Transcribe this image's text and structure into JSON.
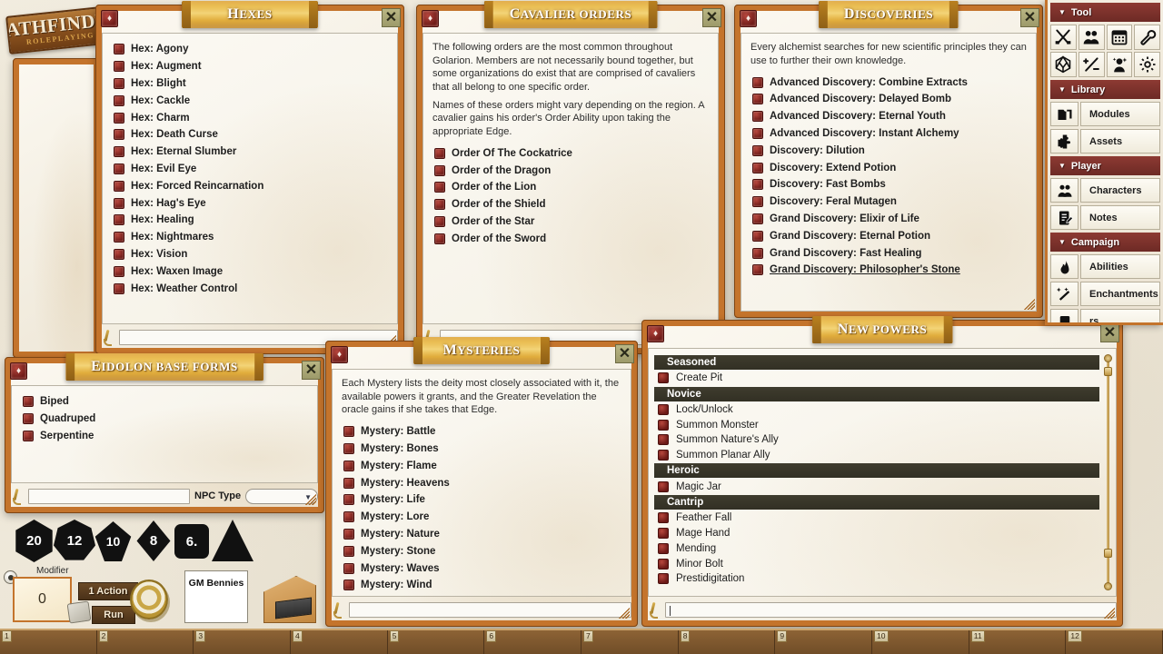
{
  "app": {
    "logo_line1": "PATHFINDER",
    "logo_line2": "ROLEPLAYING"
  },
  "windows": {
    "hexes": {
      "title": "Hexes",
      "close_label": "✕",
      "items": [
        "Hex: Agony",
        "Hex: Augment",
        "Hex: Blight",
        "Hex: Cackle",
        "Hex: Charm",
        "Hex: Death Curse",
        "Hex: Eternal Slumber",
        "Hex: Evil Eye",
        "Hex: Forced Reincarnation",
        "Hex: Hag's Eye",
        "Hex: Healing",
        "Hex: Nightmares",
        "Hex: Vision",
        "Hex: Waxen Image",
        "Hex: Weather Control"
      ],
      "input_value": ""
    },
    "cavalier_orders": {
      "title": "Cavalier Orders",
      "close_label": "✕",
      "paragraphs": [
        "The following orders are the most common throughout Golarion. Members are not necessarily bound together, but some organizations do exist that are comprised of cavaliers that all belong to one specific order.",
        "Names of these orders might vary depending on the region. A cavalier gains his order's Order Ability upon taking the appropriate Edge."
      ],
      "items": [
        "Order Of The Cockatrice",
        "Order of the Dragon",
        "Order of the Lion",
        "Order of the Shield",
        "Order of the Star",
        "Order of the Sword"
      ],
      "input_value": ""
    },
    "discoveries": {
      "title": "Discoveries",
      "close_label": "✕",
      "paragraphs": [
        "Every alchemist searches for new scientific principles they can use to further their own knowledge."
      ],
      "items": [
        "Advanced Discovery: Combine Extracts",
        "Advanced Discovery: Delayed Bomb",
        "Advanced Discovery: Eternal Youth",
        "Advanced Discovery: Instant Alchemy",
        "Discovery: Dilution",
        "Discovery: Extend Potion",
        "Discovery: Fast Bombs",
        "Discovery: Feral Mutagen",
        "Grand Discovery: Elixir of Life",
        "Grand Discovery: Eternal Potion",
        "Grand Discovery: Fast Healing",
        "Grand Discovery: Philosopher's Stone"
      ],
      "hovered_item": "Grand Discovery: Philosopher's Stone"
    },
    "eidolon": {
      "title": "Eidolon Base Forms",
      "close_label": "✕",
      "items": [
        "Biped",
        "Quadruped",
        "Serpentine"
      ],
      "input_value": "",
      "npc_type_label": "NPC Type",
      "npc_type_value": ""
    },
    "mysteries": {
      "title": "Mysteries",
      "close_label": "✕",
      "paragraphs": [
        "Each Mystery lists the deity most closely associated with it, the available powers it grants, and the Greater Revelation the oracle gains if she takes that Edge."
      ],
      "items": [
        "Mystery: Battle",
        "Mystery: Bones",
        "Mystery: Flame",
        "Mystery: Heavens",
        "Mystery: Life",
        "Mystery: Lore",
        "Mystery: Nature",
        "Mystery: Stone",
        "Mystery: Waves",
        "Mystery: Wind"
      ],
      "input_value": ""
    },
    "new_powers": {
      "title": "New Powers",
      "close_label": "✕",
      "sections": [
        {
          "heading": "Seasoned",
          "items": [
            "Create Pit"
          ]
        },
        {
          "heading": "Novice",
          "items": [
            "Lock/Unlock",
            "Summon Monster",
            "Summon Nature's Ally",
            "Summon Planar Ally"
          ]
        },
        {
          "heading": "Heroic",
          "items": [
            "Magic Jar"
          ]
        },
        {
          "heading": "Cantrip",
          "items": [
            "Feather Fall",
            "Mage Hand",
            "Mending",
            "Minor Bolt",
            "Prestidigitation"
          ]
        }
      ],
      "input_value": ""
    }
  },
  "sidebar": {
    "sections": [
      {
        "heading": "Tool",
        "type": "grid",
        "tools": [
          {
            "name": "crossed-swords-icon",
            "label": "Combat Tracker"
          },
          {
            "name": "party-icon",
            "label": "Party Sheet"
          },
          {
            "name": "calendar-icon",
            "label": "Calendar"
          },
          {
            "name": "wrench-icon",
            "label": "Options"
          },
          {
            "name": "d20-die-icon",
            "label": "Dice"
          },
          {
            "name": "plus-minus-icon",
            "label": "Modifiers"
          },
          {
            "name": "npc-sparkle-icon",
            "label": "Effects"
          },
          {
            "name": "gear-icon",
            "label": "Settings"
          }
        ]
      },
      {
        "heading": "Library",
        "type": "list",
        "items": [
          {
            "label": "Modules",
            "icon": "folder-icon"
          },
          {
            "label": "Assets",
            "icon": "puzzle-icon"
          }
        ]
      },
      {
        "heading": "Player",
        "type": "list",
        "items": [
          {
            "label": "Characters",
            "icon": "party-icon"
          },
          {
            "label": "Notes",
            "icon": "notes-icon"
          }
        ]
      },
      {
        "heading": "Campaign",
        "type": "list",
        "items": [
          {
            "label": "Abilities",
            "icon": "flame-icon"
          },
          {
            "label": "Enchantments",
            "icon": "sparkle-wand-icon"
          },
          {
            "label": "rs",
            "icon": "generic-icon"
          }
        ]
      }
    ]
  },
  "dice_tray": {
    "dice": [
      {
        "name": "d20",
        "face": "20"
      },
      {
        "name": "d12",
        "face": "12"
      },
      {
        "name": "d10",
        "face": "10"
      },
      {
        "name": "d8",
        "face": "8"
      },
      {
        "name": "d6",
        "face": "6."
      },
      {
        "name": "d4",
        "face": ""
      }
    ],
    "modifier_label": "Modifier",
    "modifier_value": "0",
    "action_button": "1 Action",
    "run_button": "Run",
    "bennies_label": "GM Bennies"
  },
  "bottom_bar": {
    "slots": [
      "1",
      "2",
      "3",
      "4",
      "5",
      "6",
      "7",
      "8",
      "9",
      "10",
      "11",
      "12"
    ]
  }
}
